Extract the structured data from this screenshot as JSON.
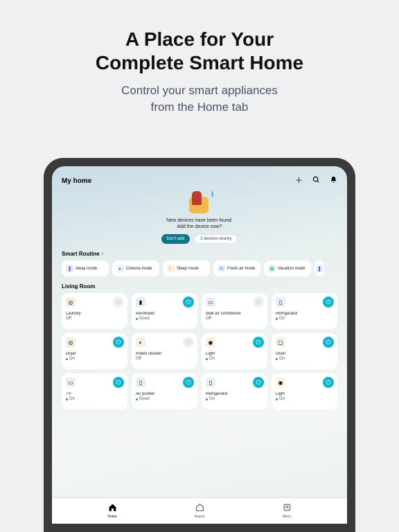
{
  "promo": {
    "title_l1": "A Place for Your",
    "title_l2": "Complete Smart Home",
    "sub_l1": "Control your smart appliances",
    "sub_l2": "from the Home tab"
  },
  "topbar": {
    "home_title": "My home"
  },
  "hero": {
    "line1": "New devices have been found.",
    "line2": "Add the device now?",
    "btn_dont": "Don't add",
    "btn_nearby": "2 devices nearby"
  },
  "sections": {
    "smart_routine": "Smart Routine",
    "living_room": "Living Room"
  },
  "routines": [
    {
      "label": "Away mode"
    },
    {
      "label": "Cinema mode"
    },
    {
      "label": "Sleep mode"
    },
    {
      "label": "Fresh air mode"
    },
    {
      "label": "Vacation mode"
    }
  ],
  "devices": [
    {
      "name": "Laundry",
      "status": "Off",
      "dot": false,
      "off": true
    },
    {
      "name": "Aerotower",
      "status": "Good",
      "dot": true,
      "off": false
    },
    {
      "name": "Wall air conditioner",
      "status": "Off",
      "dot": false,
      "off": true
    },
    {
      "name": "Refrigerator",
      "status": "On",
      "dot": true,
      "off": false
    },
    {
      "name": "Dryer",
      "status": "On",
      "dot": true,
      "off": false
    },
    {
      "name": "Robot cleaner",
      "status": "Off",
      "dot": false,
      "off": true
    },
    {
      "name": "Light",
      "status": "On",
      "dot": true,
      "off": false
    },
    {
      "name": "Oven",
      "status": "On",
      "dot": true,
      "off": false
    },
    {
      "name": "TV",
      "status": "On",
      "dot": true,
      "off": false
    },
    {
      "name": "Air purifier",
      "status": "Good",
      "dot": true,
      "off": false
    },
    {
      "name": "Refrigerator",
      "status": "On",
      "dot": true,
      "off": false
    },
    {
      "name": "Light",
      "status": "On",
      "dot": true,
      "off": false
    }
  ],
  "nav": {
    "home": "Home",
    "report": "Report",
    "menu": "Menu"
  }
}
